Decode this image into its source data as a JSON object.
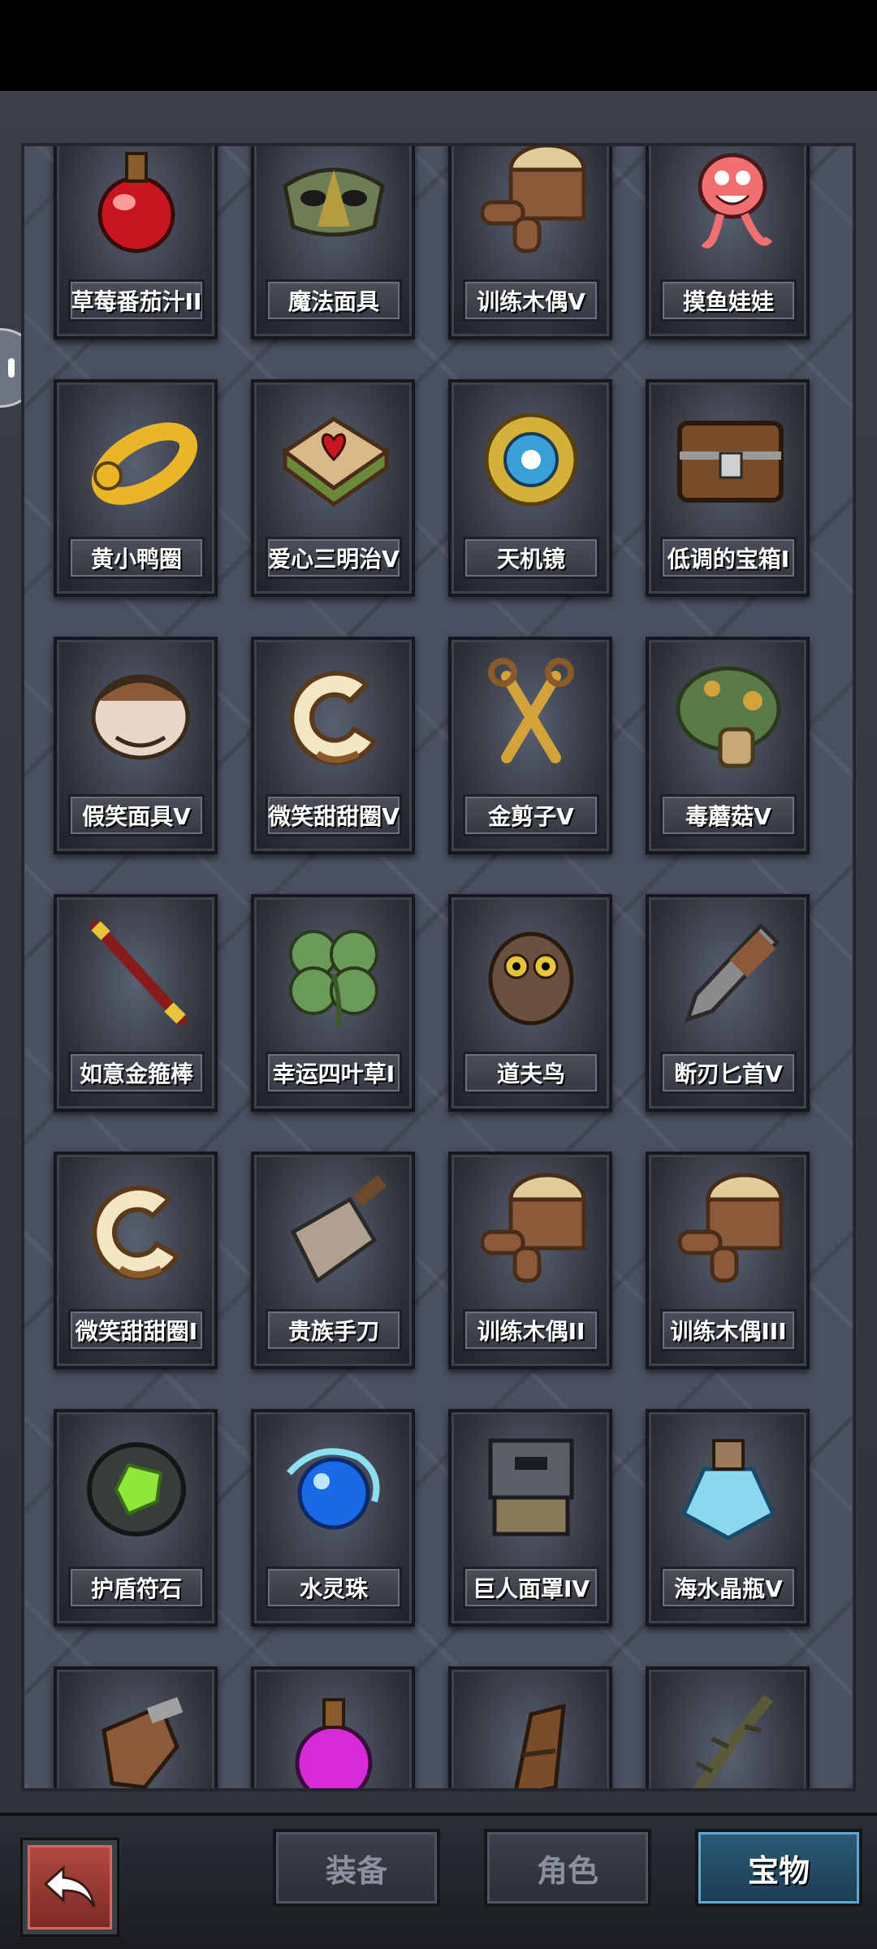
{
  "items": [
    {
      "label": "草莓番茄汁II",
      "icon": "potion-red-icon"
    },
    {
      "label": "魔法面具",
      "icon": "mask-icon"
    },
    {
      "label": "训练木偶V",
      "icon": "training-dummy-icon"
    },
    {
      "label": "摸鱼娃娃",
      "icon": "pink-doll-icon"
    },
    {
      "label": "黄小鸭圈",
      "icon": "duck-ring-icon"
    },
    {
      "label": "爱心三明治V",
      "icon": "heart-sandwich-icon"
    },
    {
      "label": "天机镜",
      "icon": "bagua-mirror-icon"
    },
    {
      "label": "低调的宝箱I",
      "icon": "treasure-chest-icon"
    },
    {
      "label": "假笑面具V",
      "icon": "fake-smile-mask-icon"
    },
    {
      "label": "微笑甜甜圈V",
      "icon": "donut-icon"
    },
    {
      "label": "金剪子V",
      "icon": "golden-scissors-icon"
    },
    {
      "label": "毒蘑菇V",
      "icon": "poison-mushroom-icon"
    },
    {
      "label": "如意金箍棒",
      "icon": "golden-staff-icon"
    },
    {
      "label": "幸运四叶草I",
      "icon": "four-leaf-clover-icon"
    },
    {
      "label": "道夫鸟",
      "icon": "owl-icon"
    },
    {
      "label": "断刃匕首V",
      "icon": "broken-dagger-icon"
    },
    {
      "label": "微笑甜甜圈I",
      "icon": "donut-icon"
    },
    {
      "label": "贵族手刀",
      "icon": "cleaver-icon"
    },
    {
      "label": "训练木偶II",
      "icon": "training-dummy-icon"
    },
    {
      "label": "训练木偶III",
      "icon": "training-dummy-icon"
    },
    {
      "label": "护盾符石",
      "icon": "shield-runestone-icon"
    },
    {
      "label": "水灵珠",
      "icon": "water-orb-icon"
    },
    {
      "label": "巨人面罩IV",
      "icon": "giant-mask-icon"
    },
    {
      "label": "海水晶瓶V",
      "icon": "crystal-bottle-icon"
    },
    {
      "label": "",
      "icon": "glove-icon"
    },
    {
      "label": "",
      "icon": "potion-pink-icon"
    },
    {
      "label": "",
      "icon": "wooden-club-icon"
    },
    {
      "label": "",
      "icon": "thorny-branch-icon"
    }
  ],
  "tabs": [
    {
      "label": "装备",
      "active": false
    },
    {
      "label": "角色",
      "active": false
    },
    {
      "label": "宝物",
      "active": true
    }
  ],
  "colors": {
    "accent_tab": "#2c5c78",
    "back_button": "#b24a40",
    "panel_bg": "#4a5060"
  }
}
